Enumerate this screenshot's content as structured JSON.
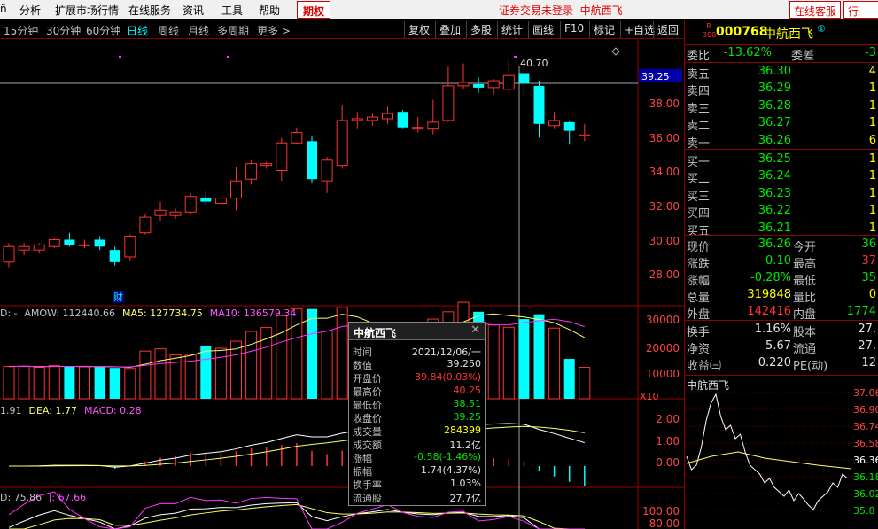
{
  "menubar": {
    "items": [
      "分析",
      "扩展市场行情",
      "在线服务",
      "资讯",
      "工具",
      "帮助"
    ],
    "qiquan": "期权",
    "login_status": "证券交易未登录",
    "stock_name_title": "中航西飞",
    "online_service": "在线客服",
    "more": "行"
  },
  "timeframes": [
    "15分钟",
    "30分钟",
    "60分钟",
    "日线",
    "周线",
    "月线",
    "多周期",
    "更多 >"
  ],
  "selected_timeframe": "日线",
  "toolbar": [
    "复权",
    "叠加",
    "多股",
    "统计",
    "画线",
    "F10",
    "标记",
    "+自选",
    "返回"
  ],
  "chart": {
    "price_axis": [
      "38.00",
      "36.00",
      "34.00",
      "32.00",
      "30.00",
      "28.00"
    ],
    "crosshair_price": "39.25",
    "high_label": "40.70",
    "cai_marker": "财",
    "vol_axis": [
      "30000",
      "20000",
      "10000"
    ],
    "vol_unit": "X10",
    "vol_legend": {
      "prefix": "D: -",
      "amow": "AMOW: 112440.66",
      "ma5": "MA5: 127734.75",
      "ma10": "MA10: 136579.34"
    },
    "macd_axis": [
      "2.00",
      "1.00",
      "0.00"
    ],
    "macd_legend": {
      "dif": "1.91",
      "dea": "DEA: 1.77",
      "macd": "MACD: 0.28"
    },
    "kdj_axis": [
      "100.00",
      "80.00"
    ],
    "kdj_legend": {
      "d": "D: 75.86",
      "j": "J: 67.66"
    },
    "colors": {
      "up": "#ff3333",
      "down": "#00ffff",
      "ma_yellow": "#ffff66",
      "ma_white": "#ffffff",
      "ma_magenta": "#ff33ff"
    }
  },
  "chart_data": {
    "type": "candlestick",
    "unit": "CNY",
    "ylim": [
      26.5,
      41.3
    ],
    "candles": [
      {
        "o": 28.9,
        "c": 29.8,
        "h": 30.0,
        "l": 28.6
      },
      {
        "o": 29.6,
        "c": 29.8,
        "h": 30.0,
        "l": 29.3
      },
      {
        "o": 29.6,
        "c": 29.9,
        "h": 30.0,
        "l": 29.4
      },
      {
        "o": 29.8,
        "c": 30.2,
        "h": 30.3,
        "l": 29.7
      },
      {
        "o": 30.2,
        "c": 29.9,
        "h": 30.6,
        "l": 29.8
      },
      {
        "o": 29.9,
        "c": 29.9,
        "h": 30.2,
        "l": 29.7
      },
      {
        "o": 30.2,
        "c": 29.8,
        "h": 30.4,
        "l": 29.6
      },
      {
        "o": 29.6,
        "c": 28.9,
        "h": 29.8,
        "l": 28.7
      },
      {
        "o": 29.2,
        "c": 30.4,
        "h": 30.5,
        "l": 29.0
      },
      {
        "o": 30.6,
        "c": 31.5,
        "h": 31.7,
        "l": 30.5
      },
      {
        "o": 31.6,
        "c": 31.9,
        "h": 32.4,
        "l": 31.3
      },
      {
        "o": 31.6,
        "c": 31.8,
        "h": 32.0,
        "l": 31.4
      },
      {
        "o": 31.8,
        "c": 32.7,
        "h": 32.9,
        "l": 31.7
      },
      {
        "o": 32.6,
        "c": 32.4,
        "h": 33.0,
        "l": 32.2
      },
      {
        "o": 32.3,
        "c": 32.6,
        "h": 32.8,
        "l": 32.2
      },
      {
        "o": 32.6,
        "c": 33.6,
        "h": 34.4,
        "l": 31.9
      },
      {
        "o": 33.7,
        "c": 34.6,
        "h": 34.8,
        "l": 33.4
      },
      {
        "o": 34.5,
        "c": 34.6,
        "h": 34.7,
        "l": 34.3
      },
      {
        "o": 34.2,
        "c": 35.8,
        "h": 36.1,
        "l": 33.6
      },
      {
        "o": 35.8,
        "c": 36.4,
        "h": 36.7,
        "l": 35.7
      },
      {
        "o": 35.9,
        "c": 33.7,
        "h": 36.2,
        "l": 33.5
      },
      {
        "o": 33.6,
        "c": 34.8,
        "h": 35.0,
        "l": 32.9
      },
      {
        "o": 34.5,
        "c": 37.1,
        "h": 38.0,
        "l": 34.3
      },
      {
        "o": 37.1,
        "c": 37.2,
        "h": 37.6,
        "l": 36.6
      },
      {
        "o": 37.1,
        "c": 37.3,
        "h": 37.5,
        "l": 36.8
      },
      {
        "o": 37.2,
        "c": 37.5,
        "h": 37.9,
        "l": 36.9
      },
      {
        "o": 37.6,
        "c": 36.7,
        "h": 37.7,
        "l": 36.6
      },
      {
        "o": 36.6,
        "c": 36.7,
        "h": 37.3,
        "l": 36.4
      },
      {
        "o": 36.6,
        "c": 37.0,
        "h": 38.3,
        "l": 36.3
      },
      {
        "o": 37.1,
        "c": 39.1,
        "h": 40.2,
        "l": 37.0
      },
      {
        "o": 39.1,
        "c": 39.3,
        "h": 40.4,
        "l": 38.9
      },
      {
        "o": 39.2,
        "c": 39.0,
        "h": 39.6,
        "l": 38.7
      },
      {
        "o": 39.0,
        "c": 39.4,
        "h": 39.5,
        "l": 38.6
      },
      {
        "o": 38.9,
        "c": 39.7,
        "h": 40.6,
        "l": 38.7
      },
      {
        "o": 39.84,
        "c": 39.25,
        "h": 40.25,
        "l": 38.51
      },
      {
        "o": 39.1,
        "c": 36.9,
        "h": 39.4,
        "l": 36.1
      },
      {
        "o": 36.8,
        "c": 37.1,
        "h": 37.6,
        "l": 36.6
      },
      {
        "o": 37.0,
        "c": 36.5,
        "h": 37.1,
        "l": 35.7
      },
      {
        "o": 36.2,
        "c": 36.26,
        "h": 36.9,
        "l": 35.9
      }
    ],
    "volume": [
      11500,
      11600,
      11200,
      11800,
      11500,
      11400,
      11300,
      11000,
      10800,
      17000,
      17800,
      15600,
      15800,
      18900,
      18000,
      20500,
      24000,
      25400,
      29700,
      32100,
      32000,
      24200,
      32600,
      25000,
      21000,
      23200,
      19700,
      23300,
      28400,
      31000,
      34400,
      31000,
      26300,
      25500,
      28400,
      30100,
      25200,
      14200,
      11200
    ]
  },
  "popup": {
    "title": "中航西飞",
    "rows": [
      {
        "label": "时间",
        "value": "2021/12/06/一",
        "color": "w"
      },
      {
        "label": "数值",
        "value": "39.250",
        "color": "w"
      },
      {
        "label": "开盘价",
        "value": "39.84(0.03%)",
        "color": "r"
      },
      {
        "label": "最高价",
        "value": "40.25",
        "color": "r"
      },
      {
        "label": "最低价",
        "value": "38.51",
        "color": "g"
      },
      {
        "label": "收盘价",
        "value": "39.25",
        "color": "g"
      },
      {
        "label": "成交量",
        "value": "284399",
        "color": "y"
      },
      {
        "label": "成交额",
        "value": "11.2亿",
        "color": "w"
      },
      {
        "label": "涨幅",
        "value": "-0.58(-1.46%)",
        "color": "g"
      },
      {
        "label": "振幅",
        "value": "1.74(4.37%)",
        "color": "w"
      },
      {
        "label": "换手率",
        "value": "1.03%",
        "color": "w"
      },
      {
        "label": "流通股",
        "value": "27.7亿",
        "color": "w"
      }
    ]
  },
  "quote": {
    "badge_top": "R",
    "badge_bottom": "300",
    "code": "000768",
    "name": "中航西飞",
    "circle": "①",
    "weibi_label": "委比",
    "weibi": "-13.62%",
    "weicha_label": "委差",
    "weicha": "-3",
    "sells": [
      {
        "label": "卖五",
        "price": "36.30",
        "vol": "4"
      },
      {
        "label": "卖四",
        "price": "36.29",
        "vol": "1"
      },
      {
        "label": "卖三",
        "price": "36.28",
        "vol": "1"
      },
      {
        "label": "卖二",
        "price": "36.27",
        "vol": "1"
      },
      {
        "label": "卖一",
        "price": "36.26",
        "vol": "6"
      }
    ],
    "buys": [
      {
        "label": "买一",
        "price": "36.25",
        "vol": "1"
      },
      {
        "label": "买二",
        "price": "36.24",
        "vol": "1"
      },
      {
        "label": "买三",
        "price": "36.23",
        "vol": "1"
      },
      {
        "label": "买四",
        "price": "36.22",
        "vol": "1"
      },
      {
        "label": "买五",
        "price": "36.21",
        "vol": "1"
      }
    ],
    "stats": [
      {
        "l1": "现价",
        "v1": "36.26",
        "c1": "g",
        "l2": "今开",
        "v2": "36",
        "c2": "g"
      },
      {
        "l1": "涨跌",
        "v1": "-0.10",
        "c1": "g",
        "l2": "最高",
        "v2": "37",
        "c2": "r"
      },
      {
        "l1": "涨幅",
        "v1": "-0.28%",
        "c1": "g",
        "l2": "最低",
        "v2": "35",
        "c2": "g"
      },
      {
        "l1": "总量",
        "v1": "319848",
        "c1": "y",
        "l2": "量比",
        "v2": "0",
        "c2": "y"
      },
      {
        "l1": "外盘",
        "v1": "142416",
        "c1": "r",
        "l2": "内盘",
        "v2": "1774",
        "c2": "g"
      }
    ],
    "stats2": [
      {
        "l1": "换手",
        "v1": "1.16%",
        "l2": "股本",
        "v2": "27."
      },
      {
        "l1": "净资",
        "v1": "5.67",
        "l2": "流通",
        "v2": "27."
      },
      {
        "l1": "收益㈢",
        "v1": "0.220",
        "l2": "PE(动)",
        "v2": "12"
      }
    ],
    "mini_title": "中航西飞",
    "mini_axis": [
      "37.06",
      "36.90",
      "36.74",
      "36.58",
      "36.36",
      "36.18",
      "36.02",
      "35.8"
    ]
  }
}
